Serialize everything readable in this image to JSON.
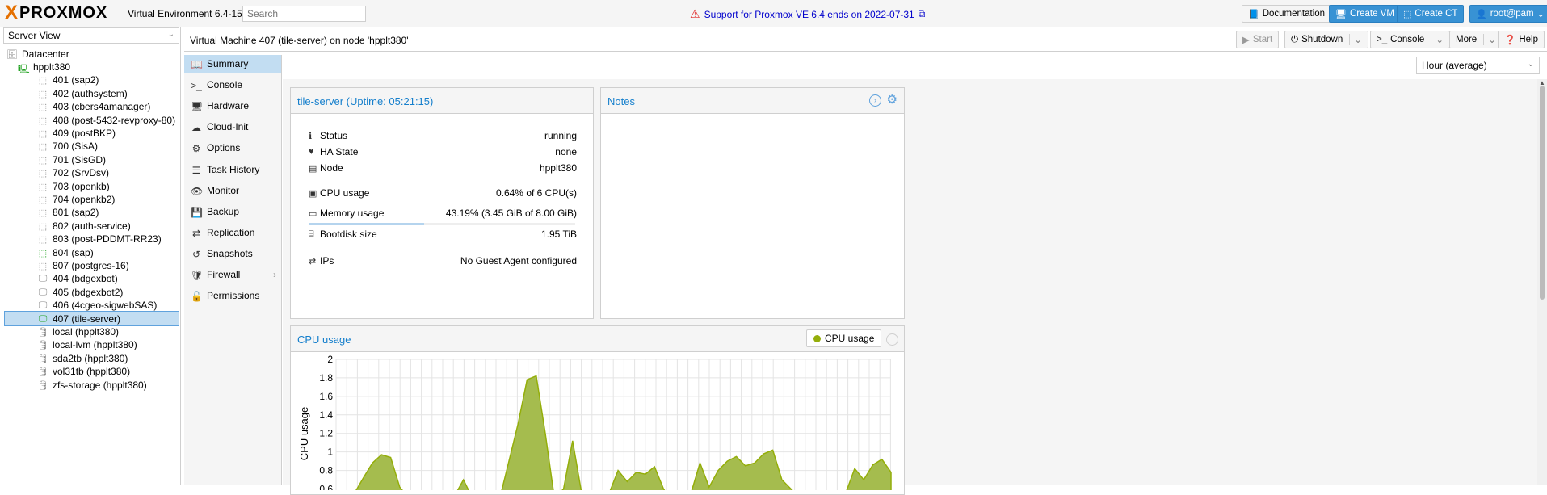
{
  "topbar": {
    "logo_x": "X",
    "logo_text": "PROXMOX",
    "version": "Virtual Environment 6.4-15",
    "search_placeholder": "Search",
    "support_text": "Support for Proxmox VE 6.4 ends on 2022-07-31",
    "documentation": "Documentation",
    "create_vm": "Create VM",
    "create_ct": "Create CT",
    "user": "root@pam"
  },
  "left": {
    "view": "Server View",
    "tree": [
      {
        "label": "Datacenter",
        "type": "datacenter",
        "level": 0
      },
      {
        "label": "hpplt380",
        "type": "node",
        "level": 1
      },
      {
        "label": "401 (sap2)",
        "type": "ct",
        "level": 2
      },
      {
        "label": "402 (authsystem)",
        "type": "ct",
        "level": 2
      },
      {
        "label": "403 (cbers4amanager)",
        "type": "ct",
        "level": 2
      },
      {
        "label": "408 (post-5432-revproxy-80)",
        "type": "ct",
        "level": 2
      },
      {
        "label": "409 (postBKP)",
        "type": "ct",
        "level": 2
      },
      {
        "label": "700 (SisA)",
        "type": "ct",
        "level": 2
      },
      {
        "label": "701 (SisGD)",
        "type": "ct",
        "level": 2
      },
      {
        "label": "702 (SrvDsv)",
        "type": "ct",
        "level": 2
      },
      {
        "label": "703 (openkb)",
        "type": "ct",
        "level": 2
      },
      {
        "label": "704 (openkb2)",
        "type": "ct",
        "level": 2
      },
      {
        "label": "801 (sap2)",
        "type": "ct",
        "level": 2
      },
      {
        "label": "802 (auth-service)",
        "type": "ct",
        "level": 2
      },
      {
        "label": "803 (post-PDDMT-RR23)",
        "type": "ct",
        "level": 2
      },
      {
        "label": "804 (sap)",
        "type": "ct-running",
        "level": 2
      },
      {
        "label": "807 (postgres-16)",
        "type": "ct",
        "level": 2
      },
      {
        "label": "404 (bdgexbot)",
        "type": "vm",
        "level": 2
      },
      {
        "label": "405 (bdgexbot2)",
        "type": "vm",
        "level": 2
      },
      {
        "label": "406 (4cgeo-sigwebSAS)",
        "type": "vm",
        "level": 2
      },
      {
        "label": "407 (tile-server)",
        "type": "vm-running",
        "level": 2,
        "selected": true
      },
      {
        "label": "local (hpplt380)",
        "type": "storage",
        "level": 2
      },
      {
        "label": "local-lvm (hpplt380)",
        "type": "storage",
        "level": 2
      },
      {
        "label": "sda2tb (hpplt380)",
        "type": "storage-zfs",
        "level": 2
      },
      {
        "label": "vol31tb (hpplt380)",
        "type": "storage",
        "level": 2
      },
      {
        "label": "zfs-storage (hpplt380)",
        "type": "storage-zfs",
        "level": 2
      }
    ]
  },
  "vm": {
    "title": "Virtual Machine 407 (tile-server) on node 'hpplt380'",
    "start": "Start",
    "shutdown": "Shutdown",
    "console": "Console",
    "more": "More",
    "help": "Help",
    "time_range": "Hour (average)"
  },
  "tabs": [
    {
      "label": "Summary",
      "icon": "book-icon",
      "active": true
    },
    {
      "label": "Console",
      "icon": "terminal-icon"
    },
    {
      "label": "Hardware",
      "icon": "desktop-icon"
    },
    {
      "label": "Cloud-Init",
      "icon": "cloud-icon"
    },
    {
      "label": "Options",
      "icon": "gear-icon"
    },
    {
      "label": "Task History",
      "icon": "list-icon"
    },
    {
      "label": "Monitor",
      "icon": "eye-icon"
    },
    {
      "label": "Backup",
      "icon": "floppy-icon"
    },
    {
      "label": "Replication",
      "icon": "retweet-icon"
    },
    {
      "label": "Snapshots",
      "icon": "history-icon"
    },
    {
      "label": "Firewall",
      "icon": "shield-icon"
    },
    {
      "label": "Permissions",
      "icon": "unlock-icon"
    }
  ],
  "status": {
    "title": "tile-server (Uptime: 05:21:15)",
    "rows": [
      {
        "label": "Status",
        "value": "running",
        "icon": "info-icon"
      },
      {
        "label": "HA State",
        "value": "none",
        "icon": "heartbeat-icon"
      },
      {
        "label": "Node",
        "value": "hpplt380",
        "icon": "server-icon"
      },
      {
        "label": "CPU usage",
        "value": "0.64% of 6 CPU(s)",
        "icon": "cpu-icon"
      },
      {
        "label": "Memory usage",
        "value": "43.19% (3.45 GiB of 8.00 GiB)",
        "icon": "memory-icon"
      },
      {
        "label": "Bootdisk size",
        "value": "1.95 TiB",
        "icon": "hdd-icon"
      },
      {
        "label": "IPs",
        "value": "No Guest Agent configured",
        "icon": "exchange-icon"
      }
    ],
    "memory_fraction": 0.4319
  },
  "notes": {
    "title": "Notes"
  },
  "cpu_chart": {
    "title": "CPU usage",
    "legend": "CPU usage",
    "color": "#94ae0a"
  },
  "chart_data": {
    "type": "area",
    "title": "CPU usage",
    "xlabel": "",
    "ylabel": "CPU usage",
    "ylim": [
      0.5,
      2
    ],
    "yticks": [
      2,
      1.8,
      1.6,
      1.4,
      1.2,
      1,
      0.8,
      0.6
    ],
    "grid": true,
    "legend": "top-right",
    "series": [
      {
        "name": "CPU usage",
        "values": [
          0.4,
          0.45,
          0.55,
          0.72,
          0.88,
          0.97,
          0.94,
          0.62,
          0.5,
          0.55,
          0.48,
          0.45,
          0.5,
          0.52,
          0.7,
          0.5,
          0.42,
          0.45,
          0.5,
          0.9,
          1.3,
          1.78,
          1.82,
          1.2,
          0.5,
          0.6,
          1.12,
          0.55,
          0.45,
          0.5,
          0.55,
          0.8,
          0.68,
          0.78,
          0.76,
          0.84,
          0.6,
          0.45,
          0.5,
          0.55,
          0.88,
          0.62,
          0.8,
          0.9,
          0.95,
          0.85,
          0.88,
          0.98,
          1.02,
          0.7,
          0.6,
          0.5,
          0.45,
          0.48,
          0.5,
          0.52,
          0.55,
          0.82,
          0.7,
          0.86,
          0.92,
          0.78
        ]
      }
    ]
  }
}
